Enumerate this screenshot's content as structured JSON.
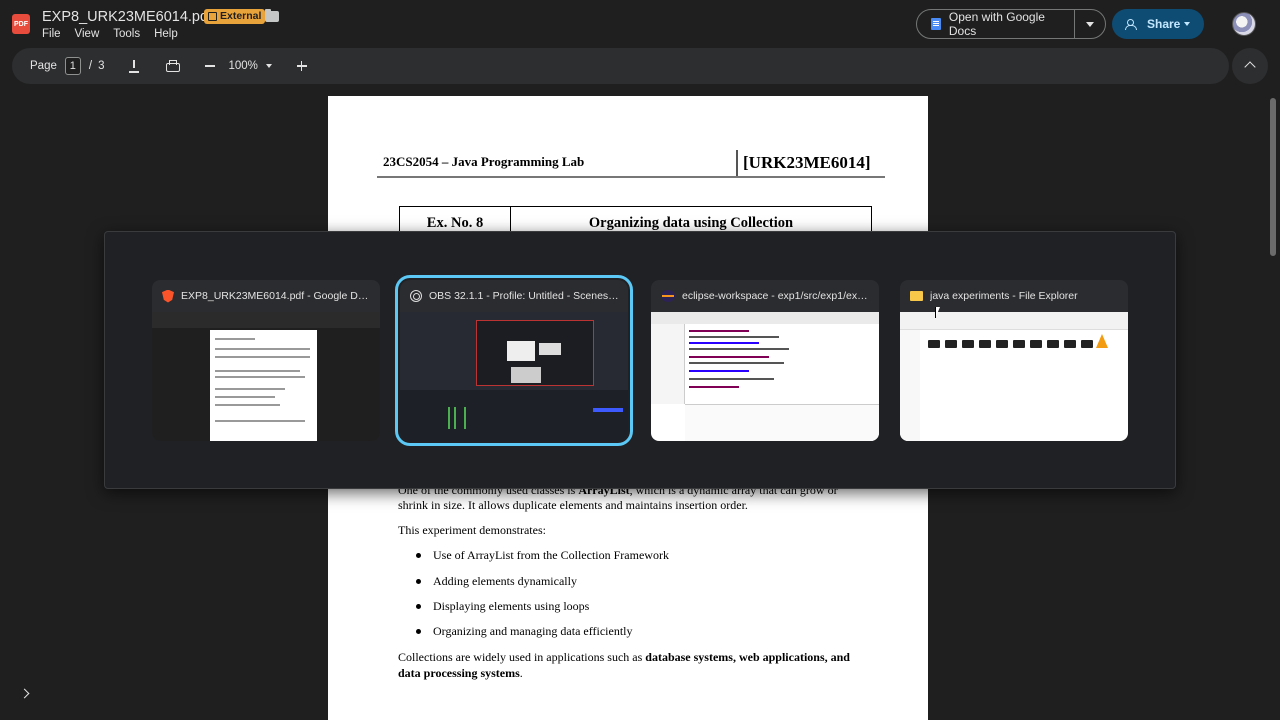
{
  "header": {
    "app_icon_label": "PDF",
    "file_name": "EXP8_URK23ME6014.pdf",
    "badge": "External",
    "menu": [
      "File",
      "View",
      "Tools",
      "Help"
    ],
    "open_with_label": "Open with Google Docs",
    "share_label": "Share"
  },
  "toolbar": {
    "page_label": "Page",
    "page_current": "1",
    "page_separator": "/",
    "page_total": "3",
    "zoom": "100%"
  },
  "document": {
    "course": "23CS2054 – Java Programming Lab",
    "reg_no": "[URK23ME6014]",
    "exp_no": "Ex. No. 8",
    "exp_title": "Organizing data using Collection",
    "para1_line1_pre": "One of the commonly used classes is ",
    "para1_line1_bold": "ArrayList",
    "para1_line1_post": ", which is a dynamic array that can grow or",
    "para1_line2": "shrink in size. It allows duplicate elements and maintains insertion order.",
    "para2": "This experiment demonstrates:",
    "bullets": [
      "Use of ArrayList from the Collection Framework",
      "Adding elements dynamically",
      "Displaying elements using loops",
      "Organizing and managing data efficiently"
    ],
    "para3_pre": "Collections are widely used in applications such as ",
    "para3_bold1": "database systems, web applications, and",
    "para3_bold2": "data processing systems",
    "para3_post": "."
  },
  "switcher": {
    "windows": [
      {
        "title": "EXP8_URK23ME6014.pdf - Google Drive...",
        "icon": "brave-icon",
        "selected": false
      },
      {
        "title": "OBS 32.1.1 - Profile: Untitled - Scenes: U...",
        "icon": "obs-icon",
        "selected": true
      },
      {
        "title": "eclipse-workspace - exp1/src/exp1/ex8.j...",
        "icon": "eclipse-icon",
        "selected": false
      },
      {
        "title": "java experiments - File Explorer",
        "icon": "folder-icon",
        "selected": false
      }
    ]
  },
  "colors": {
    "background": "#1f1f1f",
    "toolbar": "#2d2e30",
    "share_button": "#0e4c73",
    "badge": "#e8a33b",
    "selection": "#5bc8f5"
  }
}
